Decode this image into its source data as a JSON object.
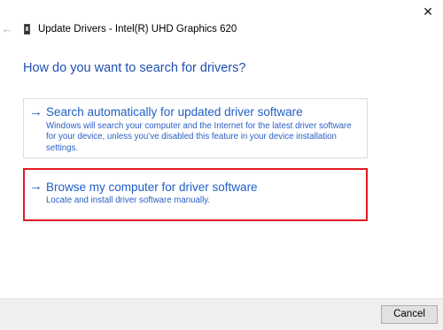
{
  "window": {
    "title": "Update Drivers - Intel(R) UHD Graphics 620",
    "back_icon": "back-arrow-icon",
    "device_icon": "display-adapter-icon",
    "close_icon": "close-icon",
    "close_glyph": "✕"
  },
  "main": {
    "heading": "How do you want to search for drivers?",
    "options": [
      {
        "icon": "right-arrow-icon",
        "arrow_glyph": "→",
        "title": "Search automatically for updated driver software",
        "description": "Windows will search your computer and the Internet for the latest driver software for your device, unless you’ve disabled this feature in your device installation settings.",
        "highlighted": false
      },
      {
        "icon": "right-arrow-icon",
        "arrow_glyph": "→",
        "title": "Browse my computer for driver software",
        "description": "Locate and install driver software manually.",
        "highlighted": true,
        "highlight_color": "#e11b22"
      }
    ]
  },
  "footer": {
    "cancel_label": "Cancel"
  },
  "colors": {
    "link_blue": "#1f5fc6",
    "heading_blue": "#1f4fb0",
    "footer_bg": "#f0f0f0"
  }
}
